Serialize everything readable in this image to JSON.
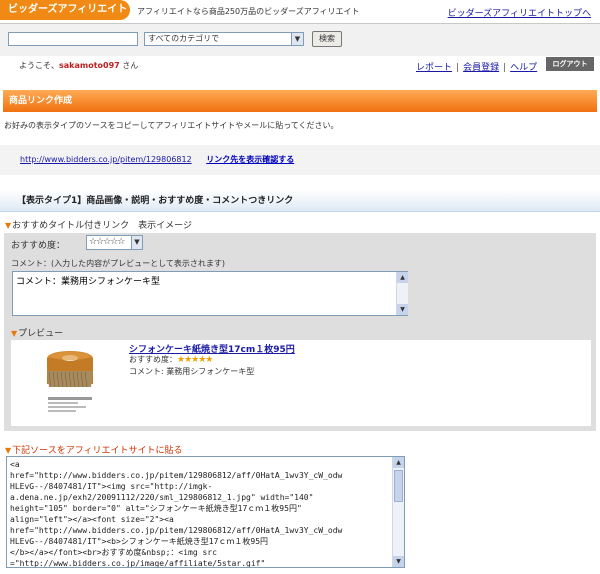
{
  "header": {
    "logo": "ビッダーズアフィリエイト",
    "tagline": "アフィリエイトなら商品250万品のビッダーズアフィリエイト",
    "top_link": "ビッダーズアフィリエイトトップへ"
  },
  "search": {
    "keyword_value": "",
    "category_selected": "すべてのカテゴリで",
    "button_label": "検索"
  },
  "user": {
    "welcome_prefix": "ようこそ、",
    "username": "sakamoto097",
    "welcome_suffix": " さん"
  },
  "nav": {
    "report": "レポート",
    "register": "会員登録",
    "help": "ヘルプ",
    "separator": "|",
    "logout": "ログアウト"
  },
  "section": {
    "title": "商品リンク作成",
    "intro": "お好みの表示タイプのソースをコピーしてアフィリエイトサイトやメールに貼ってください。"
  },
  "link": {
    "url": "http://www.bidders.co.jp/pitem/129806812",
    "confirm": "リンク先を表示確認する"
  },
  "type": {
    "title": "【表示タイプ1】商品画像・説明・おすすめ度・コメントつきリンク",
    "image_heading": "おすすめタイトル付きリンク　表示イメージ",
    "recommend_label": "おすすめ度：",
    "recommend_value": "☆☆☆☆☆",
    "comment_label": "コメント：(入力した内容がプレビューとして表示されます)",
    "comment_value": "コメント：業務用シフォンケーキ型",
    "preview_heading": "プレビュー",
    "source_heading": "下記ソースをアフィリエイトサイトに貼る"
  },
  "preview": {
    "title": "シフォンケーキ紙焼き型17cm１枚95円",
    "rec_label": "おすすめ度：",
    "rec_stars": "★★★★★",
    "comment": "コメント: 業務用シフォンケーキ型"
  },
  "source_code": "<a\nhref=\"http://www.bidders.co.jp/pitem/129806812/aff/0HatA_1wv3Y_cW_odw\nHLEvG--/8407481/IT\"><img src=\"http://imgk-\na.dena.ne.jp/exh2/20091112/220/sml_129806812_1.jpg\" width=\"140\"\nheight=\"105\" border=\"0\" alt=\"シフォンケーキ紙焼き型17ｃｍ１枚95円\"\nalign=\"left\"></a><font size=\"2\"><a\nhref=\"http://www.bidders.co.jp/pitem/129806812/aff/0HatA_1wv3Y_cW_odw\nHLEvG--/8407481/IT\"><b>シフォンケーキ紙焼き型17ｃｍ１枚95円\n</b></a></font><br>おすすめ度&nbsp;：<img src\n=\"http://www.bidders.co.jp/image/affiliate/5star.gif\"",
  "colors": {
    "accent": "#f08a14",
    "link": "#1a1aa6",
    "username": "#c02020"
  }
}
